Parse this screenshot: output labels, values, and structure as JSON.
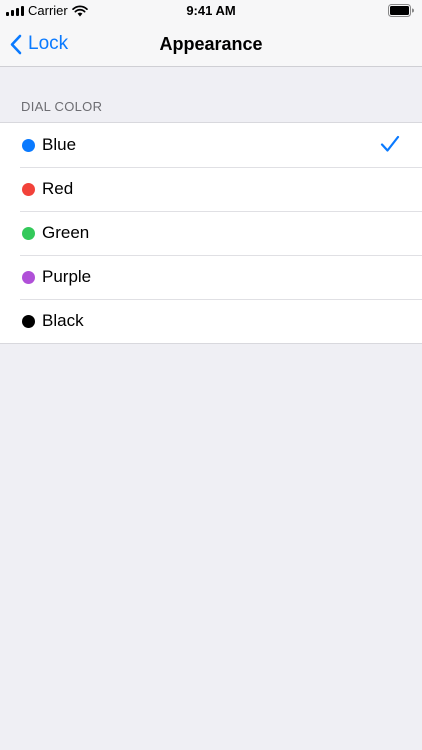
{
  "status_bar": {
    "carrier": "Carrier",
    "time": "9:41 AM"
  },
  "nav": {
    "back_label": "Lock",
    "title": "Appearance"
  },
  "section": {
    "header": "DIAL COLOR"
  },
  "colors": {
    "accent": "#0a7aff"
  },
  "options": [
    {
      "label": "Blue",
      "color": "#0a7aff",
      "selected": true
    },
    {
      "label": "Red",
      "color": "#f2423a",
      "selected": false
    },
    {
      "label": "Green",
      "color": "#33c95a",
      "selected": false
    },
    {
      "label": "Purple",
      "color": "#b050d8",
      "selected": false
    },
    {
      "label": "Black",
      "color": "#000000",
      "selected": false
    }
  ]
}
